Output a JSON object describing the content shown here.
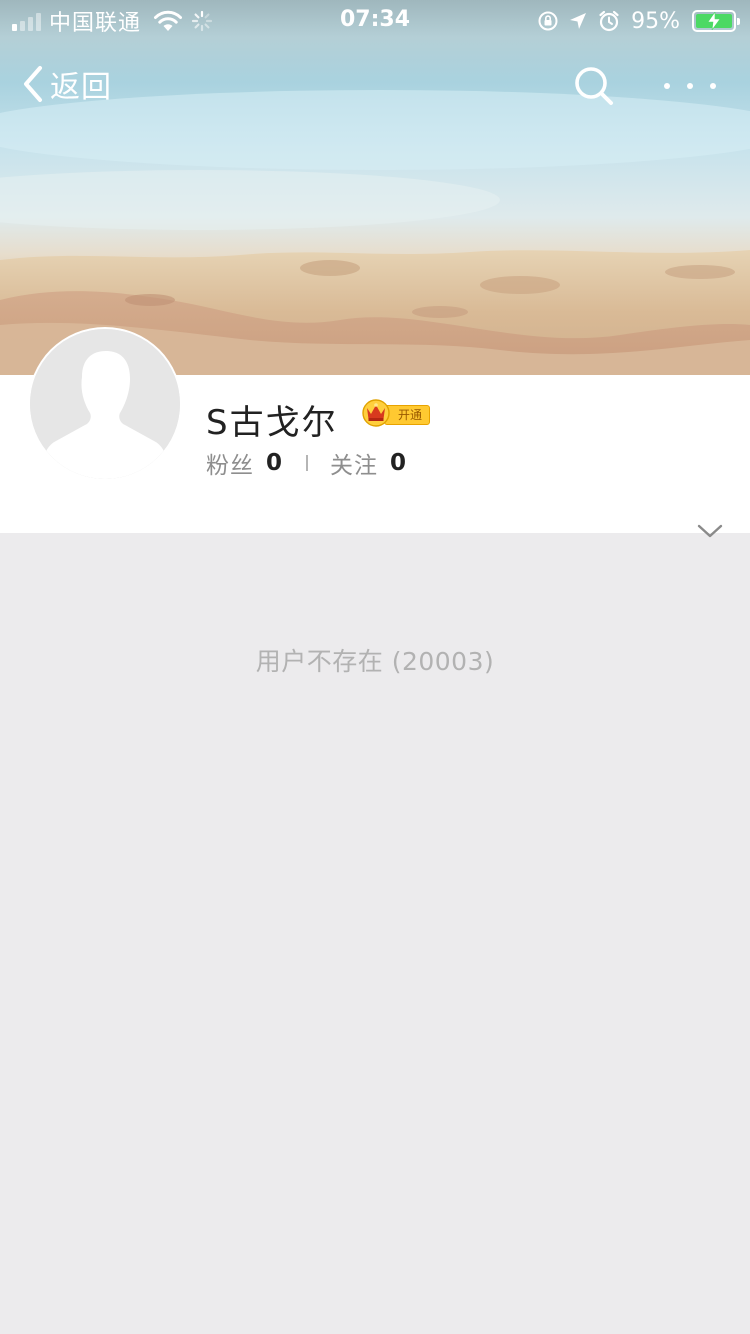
{
  "status_bar": {
    "carrier": "中国联通",
    "time": "07:34",
    "battery_percent": "95%"
  },
  "nav": {
    "back_label": "返回"
  },
  "profile": {
    "username": "S古戈尔",
    "vip_label": "开通",
    "stats": [
      {
        "label": "粉丝",
        "value": "0"
      },
      {
        "label": "关注",
        "value": "0"
      }
    ]
  },
  "content": {
    "empty_message": "用户不存在 (20003)"
  },
  "colors": {
    "accent_gold": "#ffc931",
    "battery_green": "#4cd964",
    "background": "#ecebed"
  },
  "icons": [
    "signal-icon",
    "wifi-icon",
    "loading-icon",
    "orientation-lock-icon",
    "location-icon",
    "alarm-icon",
    "battery-icon",
    "back-chevron-icon",
    "search-icon",
    "more-icon",
    "crown-icon",
    "chevron-down-icon",
    "default-avatar-icon"
  ]
}
